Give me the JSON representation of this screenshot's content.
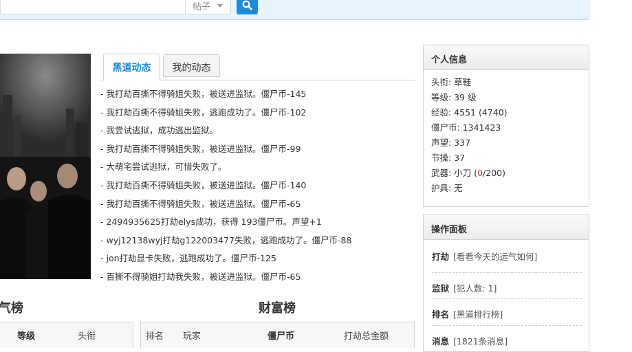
{
  "search": {
    "type_label": "帖子"
  },
  "tabs": [
    {
      "label": "黑道动态",
      "active": true
    },
    {
      "label": "我的动态",
      "active": false
    }
  ],
  "feed": [
    "- 我打劫百撕不得骑姐失败，被送进监狱。僵尸币-145",
    "- 我打劫百撕不得骑姐失败，逃跑成功了。僵尸币-102",
    "- 我尝试逃狱，成功逃出监狱。",
    "- 我打劫百撕不得骑姐失败，被送进监狱。僵尸币-99",
    "- 大萌宅尝试逃狱，可惜失败了。",
    "- 我打劫百撕不得骑姐失败，被送进监狱。僵尸币-140",
    "- 我打劫百撕不得骑姐失败，被送进监狱。僵尸币-65",
    "- 2494935625打劫elys成功，获得 193僵尸币。声望+1",
    "- wyj12138wyj打劫g122003477失败，逃跑成功了。僵尸币-88",
    "- jon打劫显卡失败，逃跑成功了。僵尸币-125",
    "- 百撕不得骑姐打劫我失败，被送进监狱。僵尸币-65"
  ],
  "rank_left": {
    "title": "气榜",
    "headers": [
      "等级",
      "头衔"
    ]
  },
  "rank_right": {
    "title": "财富榜",
    "headers": [
      "排名",
      "玩家",
      "僵尸币",
      "打劫总金额"
    ]
  },
  "personal": {
    "title": "个人信息",
    "title_label": "头衔: 草鞋",
    "level_label": "等级: 39 级",
    "exp_label": "经验: 4551 (4740)",
    "coin_label": "僵尸币: 1341423",
    "fame_label": "声望: 337",
    "integrity_label": "节操: 37",
    "weapon_prefix": "武器: 小刀 (",
    "weapon_current": "0",
    "weapon_suffix": "/200)",
    "armor_label": "护具: 无"
  },
  "ops": {
    "title": "操作面板",
    "items": [
      {
        "key": "打劫",
        "value": "[看看今天的运气如何]"
      },
      {
        "key": "监狱",
        "value": "[犯人数: 1]"
      },
      {
        "key": "排名",
        "value": "[黑道排行榜]"
      },
      {
        "key": "消息",
        "value": "[1821条消息]"
      }
    ]
  },
  "colors": {
    "accent": "#1e8bd6",
    "tab_active": "#1d8ad9",
    "topbar_bg": "#e8f3fb",
    "weapon_red": "#c93a3a"
  }
}
